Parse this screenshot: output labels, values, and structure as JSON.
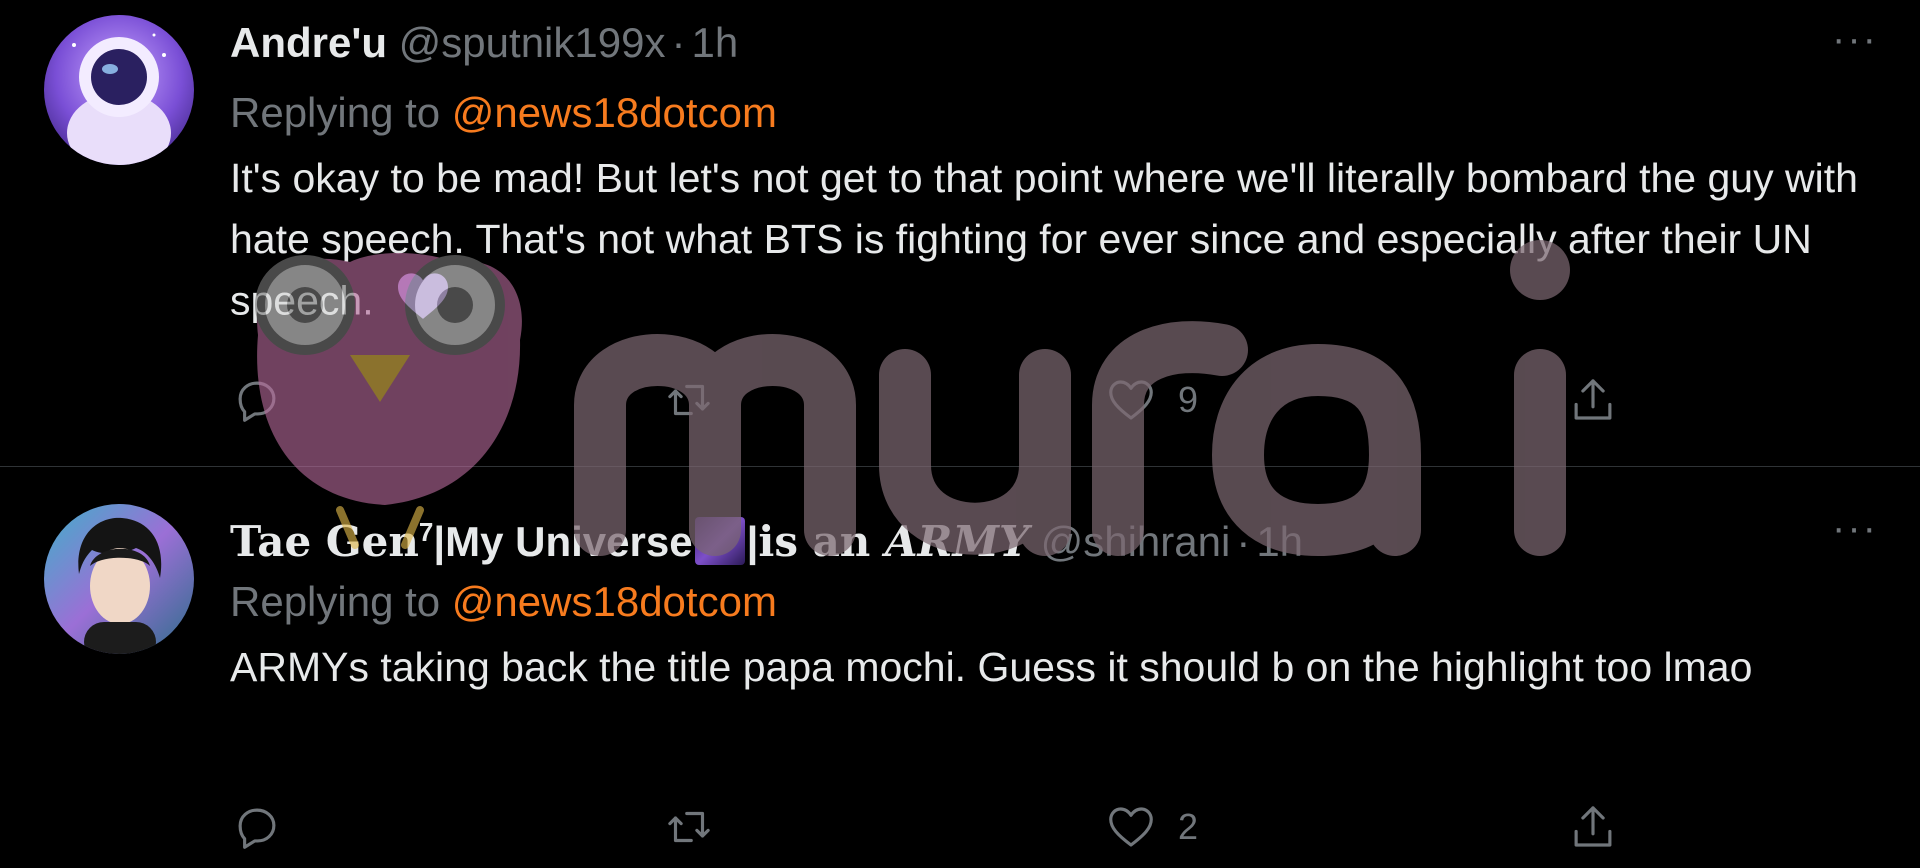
{
  "tweets": [
    {
      "display_name": "Andre'u",
      "handle": "@sputnik199x",
      "time": "1h",
      "replying_prefix": "Replying to ",
      "replying_to": "@news18dotcom",
      "text": "It's okay to be mad! But let's not get to that point where we'll literally bombard the guy with hate speech. That's not what BTS is fighting for ever since and especially after their UN speech.",
      "emoji": "purple-heart",
      "reply_count": "",
      "retweet_count": "",
      "like_count": "9"
    },
    {
      "display_name_parts": {
        "p1": "Tae Gen",
        "sup": "7",
        "p2": "|My Universe",
        "p3": "|",
        "p4": "is an ",
        "p5": "ARMY"
      },
      "handle": "@shihrani",
      "time": "1h",
      "replying_prefix": "Replying to ",
      "replying_to": "@news18dotcom",
      "text": "ARMYs taking back the title papa mochi. Guess it should b on the highlight too lmao",
      "reply_count": "",
      "retweet_count": "",
      "like_count": "2"
    }
  ],
  "more_icon": "···",
  "separator": "·",
  "watermark": {
    "text": "murai",
    "mascot": "owl-icon"
  },
  "colors": {
    "background": "#000000",
    "text": "#e7e9ea",
    "muted": "#71767b",
    "mention": "#f77b1e",
    "divider": "#2f3336",
    "emoji_heart": "#b591e8"
  }
}
